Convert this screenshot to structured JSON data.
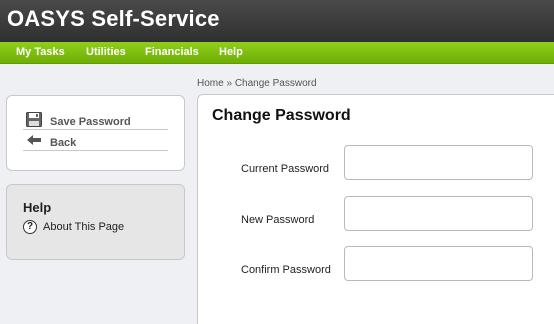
{
  "header": {
    "title": "OASYS Self-Service"
  },
  "nav": {
    "items": [
      "My Tasks",
      "Utilities",
      "Financials",
      "Help"
    ]
  },
  "breadcrumb": {
    "home": "Home",
    "separator": "»",
    "current": "Change Password"
  },
  "actions": {
    "save_label": "Save Password",
    "back_label": "Back"
  },
  "help": {
    "title": "Help",
    "about_label": "About This Page",
    "icon_glyph": "?"
  },
  "main": {
    "title": "Change Password",
    "fields": [
      {
        "label": "Current Password",
        "value": ""
      },
      {
        "label": "New Password",
        "value": ""
      },
      {
        "label": "Confirm Password",
        "value": ""
      }
    ]
  },
  "colors": {
    "nav_green": "#7cbf0e",
    "header_dark": "#3a3a3a"
  }
}
